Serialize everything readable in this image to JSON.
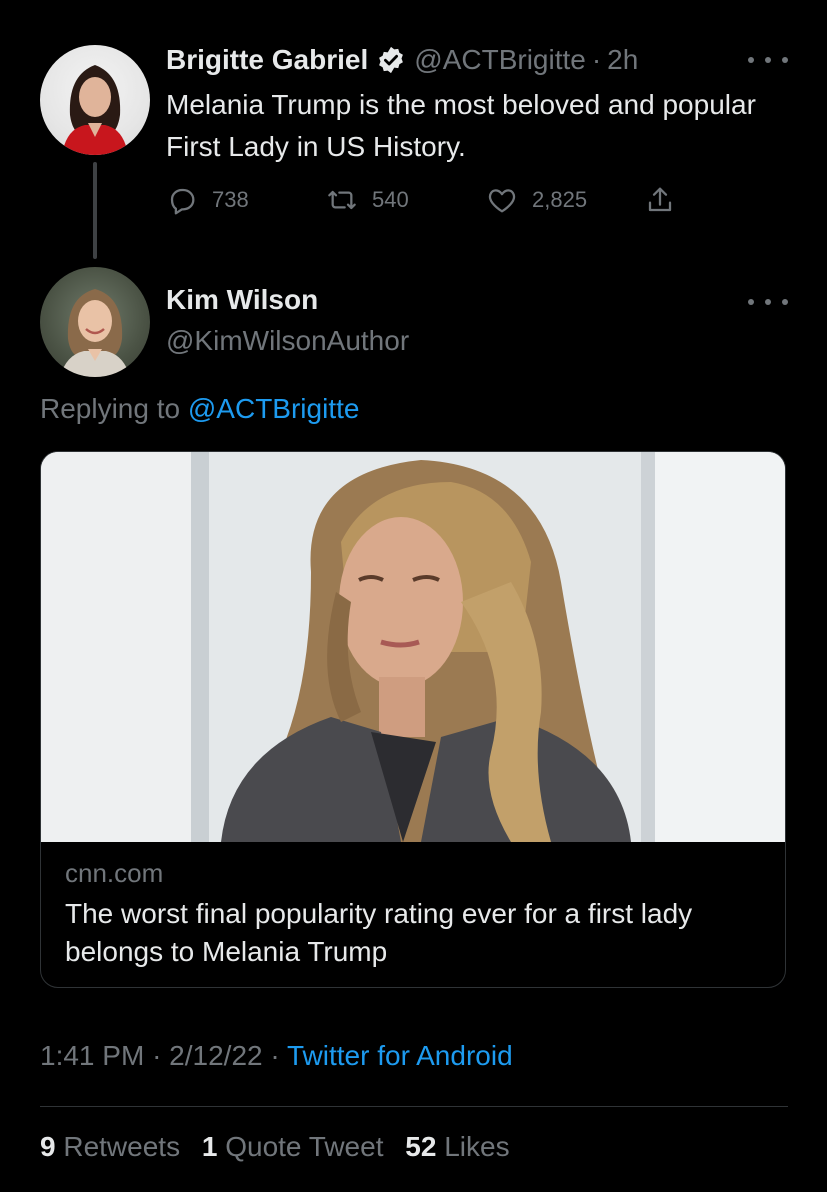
{
  "parent_tweet": {
    "display_name": "Brigitte Gabriel",
    "handle": "@ACTBrigitte",
    "separator": "·",
    "time": "2h",
    "text": "Melania Trump is the most beloved and popular First Lady in US History.",
    "replies": "738",
    "retweets": "540",
    "likes": "2,825"
  },
  "reply_tweet": {
    "display_name": "Kim Wilson",
    "handle": "@KimWilsonAuthor",
    "replying_prefix": "Replying to",
    "replying_to": "@ACTBrigitte",
    "card": {
      "domain": "cnn.com",
      "title": "The worst final popularity rating ever for a first lady belongs to Melania Trump"
    },
    "timestamp": {
      "time": "1:41 PM",
      "sep1": "·",
      "date": "2/12/22",
      "sep2": "·",
      "source": "Twitter for Android"
    },
    "stats": {
      "retweets_count": "9",
      "retweets_label": "Retweets",
      "quotes_count": "1",
      "quotes_label": "Quote Tweet",
      "likes_count": "52",
      "likes_label": "Likes"
    }
  },
  "colors": {
    "background": "#000000",
    "text": "#e7e9ea",
    "muted": "#71767b",
    "link": "#1d9bf0",
    "border": "#2f3336"
  },
  "icons": [
    "verified-badge-icon",
    "reply-icon",
    "retweet-icon",
    "like-icon",
    "share-icon",
    "more-icon"
  ]
}
